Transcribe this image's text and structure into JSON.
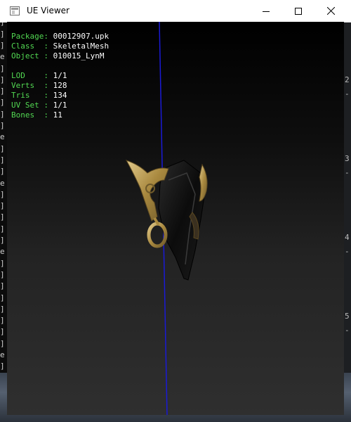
{
  "window": {
    "title": "UE Viewer",
    "controls": {
      "minimize": "minimize",
      "maximize": "maximize",
      "close": "close"
    }
  },
  "info_panel": {
    "group1": [
      {
        "label": "Package",
        "sep": ": ",
        "value": "00012907.upk"
      },
      {
        "label": "Class  ",
        "sep": ": ",
        "value": "SkeletalMesh"
      },
      {
        "label": "Object ",
        "sep": ": ",
        "value": "010015_LynM"
      }
    ],
    "group2": [
      {
        "label": "LOD    ",
        "sep": ": ",
        "value": "1/1"
      },
      {
        "label": "Verts  ",
        "sep": ": ",
        "value": "128"
      },
      {
        "label": "Tris   ",
        "sep": ": ",
        "value": "134"
      },
      {
        "label": "UV Set ",
        "sep": ": ",
        "value": "1/1"
      },
      {
        "label": "Bones  ",
        "sep": ": ",
        "value": "11"
      }
    ]
  },
  "colors": {
    "label": "#52d852",
    "value": "#ffffff",
    "axis": "#1a1ad6",
    "mesh_leather": "#111111",
    "mesh_gold": "#b89a55"
  },
  "background_console": {
    "left_glyphs": [
      "]",
      "]",
      "]",
      "]",
      "e",
      "]",
      "]",
      "]",
      "]",
      "]",
      "]",
      "e",
      "]",
      "]",
      "]",
      "e",
      "]",
      "]",
      "]",
      "]",
      "]",
      "e",
      "]",
      "]",
      "]",
      "]",
      "]",
      "]",
      "]",
      "]",
      "e",
      "]",
      "]"
    ],
    "right_glyphs": [
      "2",
      "-",
      "3",
      "-",
      "4",
      "-",
      "5",
      "-"
    ]
  }
}
